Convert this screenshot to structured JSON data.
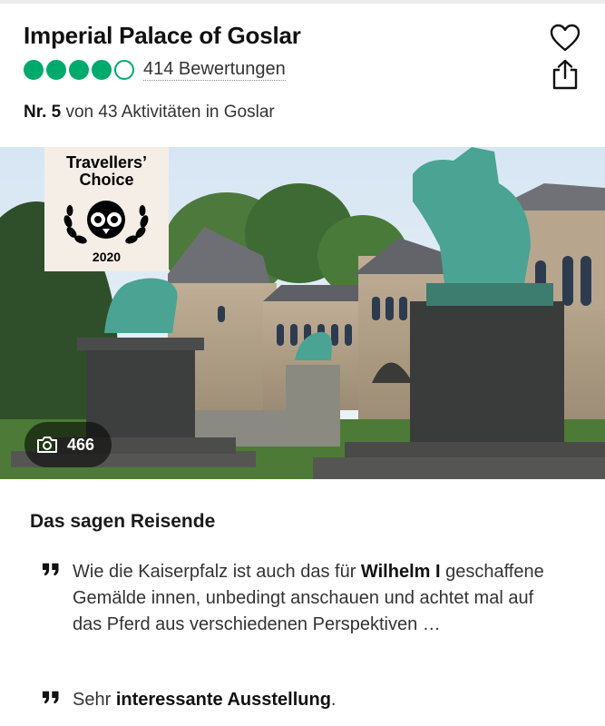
{
  "attraction": {
    "title": "Imperial Palace of Goslar",
    "rating": {
      "bubbles_filled": 4,
      "bubbles_total": 5
    },
    "reviews_label": "414 Bewertungen",
    "rank_label": "Nr. 5",
    "rank_rest": " von 43 Aktivitäten in Goslar"
  },
  "actions": {
    "save_icon": "heart-icon",
    "share_icon": "share-icon"
  },
  "photo": {
    "badge_title_1": "Travellers’",
    "badge_title_2": "Choice",
    "badge_year": "2020",
    "count": "466",
    "count_icon": "camera-icon"
  },
  "reviews_section": {
    "title": "Das sagen Reisende",
    "quotes": [
      {
        "pre": "Wie die Kaiserpfalz ist auch das für ",
        "bold": "Wilhelm I",
        "post": " geschaffene Gemälde innen, unbedingt anschauen und achtet mal auf das Pferd aus verschiedenen Perspektiven …"
      },
      {
        "pre": "Sehr ",
        "bold": "interessante Ausstellung",
        "post": "."
      }
    ]
  },
  "colors": {
    "rating_green": "#00aa6c",
    "badge_bg": "#f5eee6"
  }
}
